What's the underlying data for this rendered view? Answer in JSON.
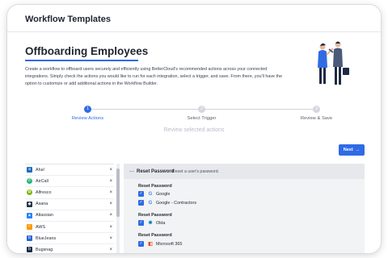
{
  "app": {
    "title": "Workflow Templates"
  },
  "page": {
    "title": "Offboarding Employees",
    "description": "Create a workflow to offboard users securely and efficiently using BetterCloud's recommended actions across your connected integrations. Simply check the actions you would like to run for each integration, select a trigger, and save. From there, you'll have the option to customize or add additional actions in the Workflow Builder."
  },
  "stepper": {
    "steps": [
      {
        "number": "1",
        "label": "Review Actions",
        "active": true
      },
      {
        "number": "2",
        "label": "Select Trigger",
        "active": false
      },
      {
        "number": "3",
        "label": "Review & Save",
        "active": false
      }
    ],
    "subtitle": "Review selected actions"
  },
  "next_button": {
    "label": "Next",
    "icon": "arrow-right-icon"
  },
  "integrations": [
    {
      "name": "Aha!",
      "icon": "aha-icon",
      "color": "#1b6fbf",
      "glyph": "a"
    },
    {
      "name": "AirCall",
      "icon": "aircall-icon",
      "color": "#22b573",
      "glyph": "✆"
    },
    {
      "name": "Alfresco",
      "icon": "alfresco-icon",
      "color": "#7ab800",
      "glyph": "✿"
    },
    {
      "name": "Asana",
      "icon": "asana-icon",
      "color": "#273347",
      "glyph": "◆"
    },
    {
      "name": "Atlassian",
      "icon": "atlassian-icon",
      "color": "#2684ff",
      "glyph": "▲"
    },
    {
      "name": "AWS",
      "icon": "aws-icon",
      "color": "#ff9900",
      "glyph": "≈"
    },
    {
      "name": "BlueJeans",
      "icon": "bluejeans-icon",
      "color": "#2b66d9",
      "glyph": "b"
    },
    {
      "name": "Bugsnag",
      "icon": "bugsnag-icon",
      "color": "#1c2b4a",
      "glyph": "b"
    }
  ],
  "remove_glyph": "×",
  "action": {
    "name": "Reset Password",
    "description": "Reset a user's password.",
    "groups": [
      {
        "title": "Reset Password",
        "items": [
          {
            "label": "Google",
            "icon": "google-icon",
            "checked": true
          },
          {
            "label": "Google - Contractors",
            "icon": "google-icon",
            "checked": true
          }
        ]
      },
      {
        "title": "Reset Password",
        "items": [
          {
            "label": "Okta",
            "icon": "okta-icon",
            "checked": true
          }
        ]
      },
      {
        "title": "Reset Password",
        "items": [
          {
            "label": "Microsoft 365",
            "icon": "microsoft-365-icon",
            "checked": true
          }
        ]
      }
    ]
  },
  "colors": {
    "accent": "#2f6be5",
    "text": "#1f2430",
    "muted": "#b9bec8"
  }
}
